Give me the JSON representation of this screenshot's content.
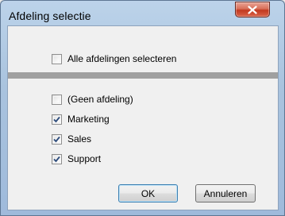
{
  "window": {
    "title": "Afdeling selectie"
  },
  "select_all": {
    "label": "Alle afdelingen selecteren",
    "checked": false
  },
  "departments": [
    {
      "label": "(Geen afdeling)",
      "checked": false
    },
    {
      "label": "Marketing",
      "checked": true
    },
    {
      "label": "Sales",
      "checked": true
    },
    {
      "label": "Support",
      "checked": true
    }
  ],
  "buttons": {
    "ok_label": "OK",
    "cancel_label": "Annuleren"
  },
  "icons": {
    "close": "close-icon",
    "check": "checkmark-icon"
  },
  "colors": {
    "close_button": "#c2391f",
    "separator": "#a0a0a0",
    "default_button_border": "#3c7fb1"
  }
}
